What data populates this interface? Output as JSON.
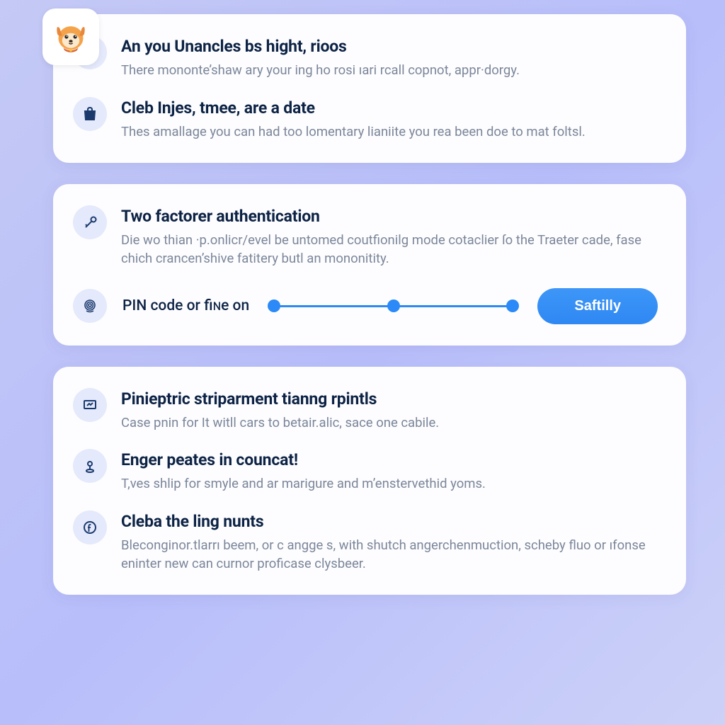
{
  "card1": {
    "rows": [
      {
        "badge_top": "354",
        "badge_bottom": "0",
        "title": "An you Unancles bs hight, rioos",
        "desc": "There mononte’shaw ary your ing ho rosi ıari rcall copnot, appr·dorgy."
      },
      {
        "title": "Cleb Injes, tmee, are a date",
        "desc": "Thes amallage you can had too lomentary lianiite you rea been doe to mat foltsl."
      }
    ]
  },
  "card2": {
    "title": "Two factorer authentication",
    "desc": "Die wo thian ·p.onlicr/evel be untomed coutfionilg mode cotaclier ſo the Traeter cade, fase chich crancen’shive fatitery butl an mononitity.",
    "slider_label": "PIN code or fiɴe on",
    "button": "Saftilly"
  },
  "card3": {
    "rows": [
      {
        "title": "Pinieptric striparment tianng rpintls",
        "desc": "Case pnin for It witll cars to betair.alic, sace one cabile."
      },
      {
        "title": "Enger peates in councat!",
        "desc": "T,ves shlip for smyle and ar marigure and m’enstervethid yoms."
      },
      {
        "title": "Cleba the ling nunts",
        "desc": "Bleconginor.tlarrı beem, or c angge s, with shutch angerchenmuction, scheby fluo or ıfonse eninter new can curnor proficase clysbeer."
      }
    ]
  }
}
